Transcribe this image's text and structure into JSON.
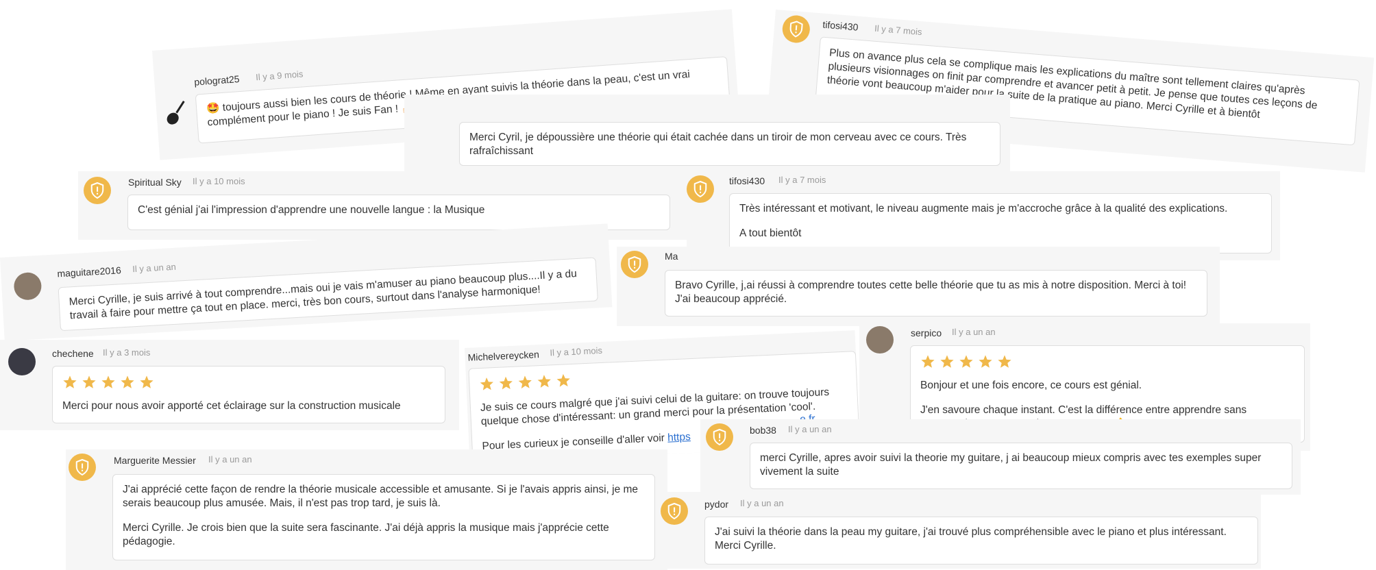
{
  "colors": {
    "accent": "#f0b84a",
    "card_bg": "#f6f6f6",
    "bubble_border": "#dedede",
    "time": "#9a9a9a",
    "link": "#2a6fd0"
  },
  "icons": {
    "badge": "shield-icon",
    "rating": "star-icon"
  },
  "reviews": [
    {
      "user": "polograt25",
      "time": "Il y a 9 mois",
      "avatar": "guitar-avatar",
      "text": "🤩 toujours aussi bien les cours de théorie ! Même en ayant suivis la théorie dans la peau, c'est un vrai complément pour le piano ! Je suis Fan ! 👍🏻"
    },
    {
      "user": "tifosi430",
      "time": "Il y a 7 mois",
      "avatar": "shield-icon",
      "text": "Plus on avance plus cela se complique mais les explications du maître sont tellement claires qu'après plusieurs visionnages on finit par comprendre et avancer petit à petit. Je pense que toutes ces leçons de théorie vont beaucoup m'aider pour la suite de la pratique au piano. Merci Cyrille et à bientôt"
    },
    {
      "user": "",
      "time": "",
      "avatar": "",
      "text": "Merci Cyril, je dépoussière une théorie qui était cachée dans un tiroir de mon cerveau avec ce cours. Très rafraîchissant"
    },
    {
      "user": "Spiritual Sky",
      "time": "Il y a 10 mois",
      "avatar": "shield-icon",
      "text": "C'est génial j'ai l'impression d'apprendre une nouvelle langue : la Musique"
    },
    {
      "user": "tifosi430",
      "time": "Il y a 7 mois",
      "avatar": "shield-icon",
      "text": "Très intéressant et motivant, le niveau augmente mais je m'accroche grâce à la qualité des explications.",
      "text2": "A tout bientôt"
    },
    {
      "user": "maguitare2016",
      "time": "Il y a un an",
      "avatar": "photo",
      "text": "Merci Cyrille, je suis arrivé à tout comprendre...mais oui je vais m'amuser au piano beaucoup plus....Il y a du travail à faire pour mettre ça tout en place. merci, très bon cours, surtout dans l'analyse harmonique!"
    },
    {
      "user": "Ma",
      "time": "",
      "avatar": "shield-icon",
      "text": "Bravo Cyrille, j,ai réussi à comprendre toutes cette belle théorie que tu as mis à notre disposition. Merci à toi! J'ai beaucoup apprécié."
    },
    {
      "user": "chechene",
      "time": "Il y a 3 mois",
      "avatar": "photo",
      "stars": 5,
      "text": "Merci pour nous avoir apporté cet éclairage sur la construction musicale"
    },
    {
      "user": "Michelvereycken",
      "time": "Il y a 10 mois",
      "avatar": "",
      "stars": 5,
      "text": "Je suis ce cours malgré que j'ai suivi celui de la guitare: on trouve toujours quelque chose d'intéressant: un grand merci pour la présentation 'cool'.",
      "text2": "Pour les curieux je conseille d'aller voir",
      "link": "https",
      "link_tail": "e.fr"
    },
    {
      "user": "serpico",
      "time": "Il y a un an",
      "avatar": "photo",
      "stars": 5,
      "text": "Bonjour et une fois encore, ce cours est génial.",
      "text2": "J'en savoure chaque instant. C'est la différence entre apprendre sans comprendre et comprendre en apprenant👌"
    },
    {
      "user": "bob38",
      "time": "Il y a un an",
      "avatar": "shield-icon",
      "text": "merci Cyrille, apres avoir suivi la theorie my guitare, j ai beaucoup mieux compris avec tes exemples super vivement la suite"
    },
    {
      "user": "Marguerite Messier",
      "time": "Il y a un an",
      "avatar": "shield-icon",
      "text": "J'ai apprécié cette façon de rendre la théorie musicale accessible et amusante. Si je l'avais appris ainsi, je me serais beaucoup plus amusée. Mais, il n'est pas trop tard, je suis là.",
      "text2": "Merci Cyrille. Je crois bien que la suite sera fascinante. J'ai déjà appris la musique mais j'apprécie cette pédagogie."
    },
    {
      "user": "pydor",
      "time": "Il y a un an",
      "avatar": "shield-icon",
      "text": "J'ai suivi la théorie dans la peau my guitare, j'ai trouvé plus compréhensible avec le piano et plus intéressant. Merci Cyrille."
    }
  ]
}
